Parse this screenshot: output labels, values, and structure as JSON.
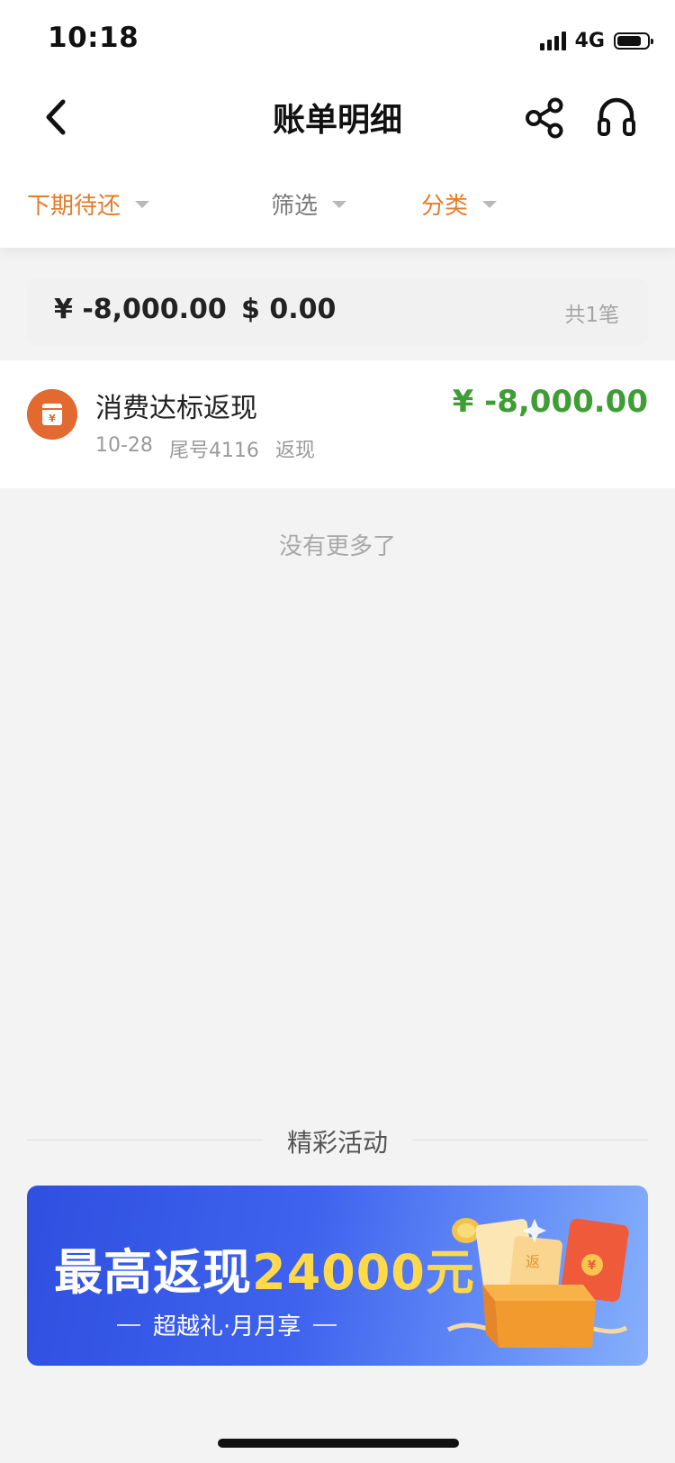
{
  "status_bar": {
    "time": "10:18",
    "network": "4G",
    "battery_level": 0.8
  },
  "header": {
    "title": "账单明细",
    "icons": [
      "back-icon",
      "share-icon",
      "headset-icon"
    ]
  },
  "filters": [
    {
      "label": "下期待还",
      "active": true
    },
    {
      "label": "筛选",
      "active": false
    },
    {
      "label": "分类",
      "active": true
    }
  ],
  "summary": {
    "cny_total": "¥ -8,000.00",
    "usd_total": "$ 0.00",
    "count": "共1笔"
  },
  "transactions": [
    {
      "title": "消费达标返现",
      "date": "10-28",
      "card": "尾号4116",
      "type": "返现",
      "amount": "¥ -8,000.00",
      "icon": "cashback-icon"
    }
  ],
  "list_end_text": "没有更多了",
  "activities": {
    "section_title": "精彩活动",
    "banner": {
      "headline_prefix": "最高返现",
      "headline_highlight": "24000元",
      "subtitle": "超越礼·月月享",
      "icon": "gift-box-illustration"
    }
  },
  "colors": {
    "accent_orange": "#e37d2c",
    "amount_green": "#3f9d35",
    "icon_orange": "#e2692f",
    "banner_blue": "#3f63ee",
    "highlight_yellow": "#ffd94a"
  }
}
